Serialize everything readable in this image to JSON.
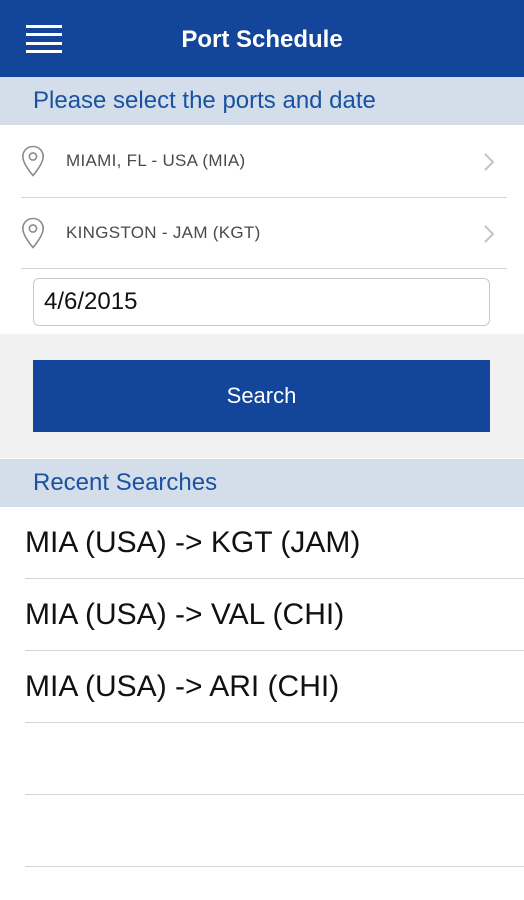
{
  "header": {
    "title": "Port Schedule",
    "menu_icon": "hamburger-menu-icon"
  },
  "form": {
    "section_title": "Please select the ports and date",
    "origin": {
      "label": "MIAMI, FL - USA (MIA)",
      "icon": "location-pin-icon"
    },
    "destination": {
      "label": "KINGSTON - JAM (KGT)",
      "icon": "location-pin-icon"
    },
    "date": {
      "value": "4/6/2015"
    },
    "search_label": "Search"
  },
  "recent": {
    "title": "Recent Searches",
    "items": [
      {
        "label": "MIA (USA) -> KGT (JAM)"
      },
      {
        "label": "MIA (USA) -> VAL (CHI)"
      },
      {
        "label": "MIA (USA) -> ARI (CHI)"
      }
    ]
  },
  "colors": {
    "primary": "#13469a",
    "section_bg": "#d3deea",
    "section_text": "#1a52a1",
    "search_area_bg": "#f1f1f1"
  }
}
